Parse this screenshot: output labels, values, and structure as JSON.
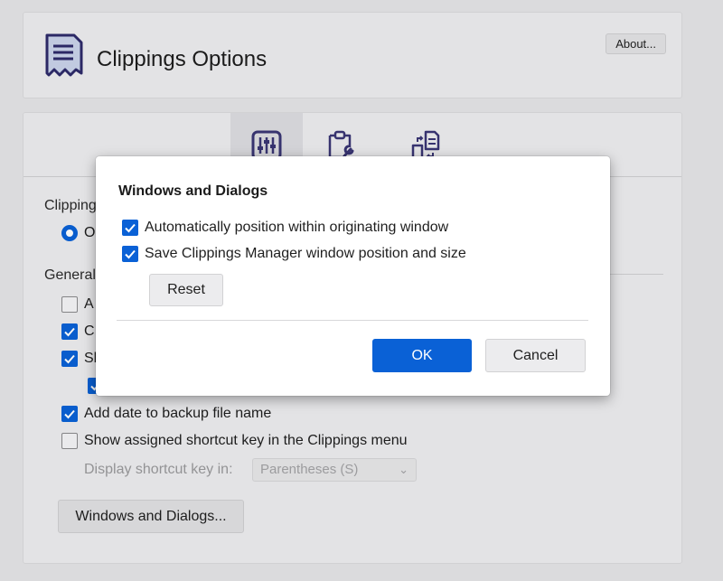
{
  "header": {
    "title": "Clippings Options",
    "about_label": "About..."
  },
  "tabs": [
    {
      "icon": "sliders-icon",
      "active": true
    },
    {
      "icon": "clipboard-wrench-icon",
      "active": false
    },
    {
      "icon": "sync-icon",
      "active": false
    }
  ],
  "main": {
    "section1_label": "Clipping",
    "radio_label": "O",
    "section2_label": "General",
    "options": [
      {
        "label": "A",
        "checked": false
      },
      {
        "label": "C",
        "checked": true
      },
      {
        "label": "Sl",
        "checked": true
      },
      {
        "label": "Add date to backup file name",
        "checked": true
      },
      {
        "label": "Show assigned shortcut key in the Clippings menu",
        "checked": false
      }
    ],
    "shortcut_display_label": "Display shortcut key in:",
    "shortcut_display_value": "Parentheses (S)",
    "windows_dialogs_button": "Windows and Dialogs..."
  },
  "dialog": {
    "title": "Windows and Dialogs",
    "options": [
      {
        "label": "Automatically position within originating window",
        "checked": true
      },
      {
        "label": "Save Clippings Manager window position and size",
        "checked": true
      }
    ],
    "reset_label": "Reset",
    "ok_label": "OK",
    "cancel_label": "Cancel"
  },
  "colors": {
    "accent": "#0a61d6",
    "background": "#e4e4e6",
    "icon_purple": "#3a3674"
  }
}
